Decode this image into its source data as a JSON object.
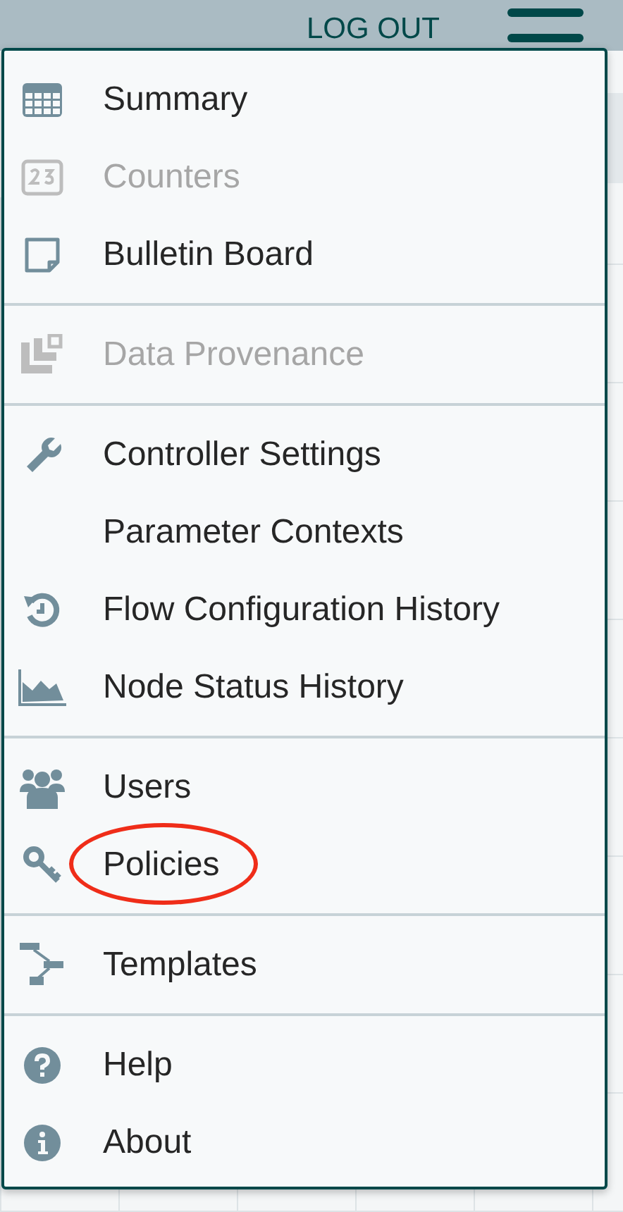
{
  "header": {
    "logout": "LOG OUT"
  },
  "menu": {
    "groups": [
      {
        "items": [
          {
            "kind": "table",
            "label": "Summary",
            "disabled": false,
            "circled": false
          },
          {
            "kind": "counter",
            "label": "Counters",
            "disabled": true,
            "circled": false
          },
          {
            "kind": "note",
            "label": "Bulletin Board",
            "disabled": false,
            "circled": false
          }
        ]
      },
      {
        "items": [
          {
            "kind": "provenance",
            "label": "Data Provenance",
            "disabled": true,
            "circled": false
          }
        ]
      },
      {
        "items": [
          {
            "kind": "wrench",
            "label": "Controller Settings",
            "disabled": false,
            "circled": false
          },
          {
            "kind": "plain",
            "label": "Parameter Contexts",
            "disabled": false,
            "circled": false
          },
          {
            "kind": "history",
            "label": "Flow Configuration History",
            "disabled": false,
            "circled": false
          },
          {
            "kind": "area",
            "label": "Node Status History",
            "disabled": false,
            "circled": false
          }
        ]
      },
      {
        "items": [
          {
            "kind": "users",
            "label": "Users",
            "disabled": false,
            "circled": false
          },
          {
            "kind": "key",
            "label": "Policies",
            "disabled": false,
            "circled": true
          }
        ]
      },
      {
        "items": [
          {
            "kind": "templates",
            "label": "Templates",
            "disabled": false,
            "circled": false
          }
        ]
      },
      {
        "items": [
          {
            "kind": "help",
            "label": "Help",
            "disabled": false,
            "circled": false
          },
          {
            "kind": "info",
            "label": "About",
            "disabled": false,
            "circled": false
          }
        ]
      }
    ]
  }
}
